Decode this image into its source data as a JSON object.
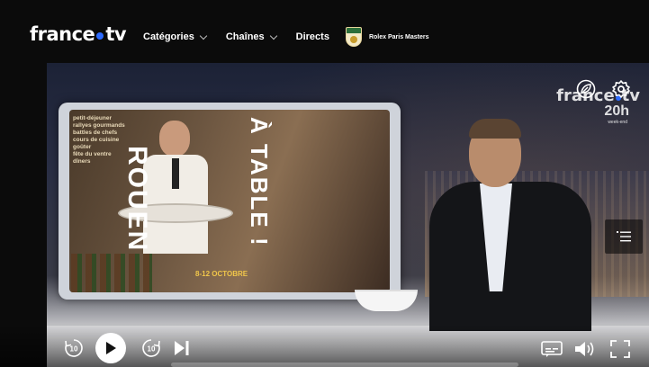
{
  "brand": {
    "logo_left": "france",
    "logo_right": "tv"
  },
  "nav": {
    "items": [
      {
        "label": "Catégories",
        "has_dropdown": true
      },
      {
        "label": "Chaînes",
        "has_dropdown": true
      },
      {
        "label": "Directs",
        "has_dropdown": false
      }
    ],
    "event_label": "Rolex Paris Masters"
  },
  "video": {
    "promo": {
      "list": [
        "petit-déjeuner",
        "rallyes gourmands",
        "battles de chefs",
        "cours de cuisine",
        "goûter",
        "fête du ventre",
        "dîners"
      ],
      "title_a": "ROUEN",
      "title_b": "À TABLE !",
      "dates": "8-12 OCTOBRE"
    },
    "channel": {
      "brand_left": "france",
      "brand_right": "tv",
      "hour": "20h",
      "sub": "week-end"
    }
  },
  "icons": {
    "eco": "leaf-icon",
    "settings": "gear-icon",
    "chapters": "list-icon",
    "rewind": "rewind-10-icon",
    "play": "play-icon",
    "forward": "forward-10-icon",
    "next": "skip-next-icon",
    "subtitles": "subtitles-icon",
    "volume": "volume-icon",
    "fullscreen": "fullscreen-icon"
  },
  "controls": {
    "rewind_label": "10",
    "forward_label": "10"
  },
  "colors": {
    "accent": "#2d6bff",
    "background": "#0b0b0b"
  }
}
